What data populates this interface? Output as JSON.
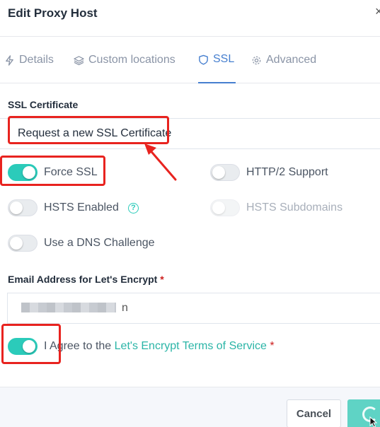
{
  "dialog": {
    "title": "Edit Proxy Host",
    "close_label": "×"
  },
  "tabs": [
    {
      "label": "Details",
      "icon": "bolt-icon",
      "active": false
    },
    {
      "label": "Custom locations",
      "icon": "layers-icon",
      "active": false
    },
    {
      "label": "SSL",
      "icon": "shield-icon",
      "active": true
    },
    {
      "label": "Advanced",
      "icon": "gear-icon",
      "active": false
    }
  ],
  "ssl": {
    "certificate_label": "SSL Certificate",
    "certificate_value": "Request a new SSL Certificate",
    "toggles": {
      "force_ssl": {
        "label": "Force SSL",
        "on": true
      },
      "http2": {
        "label": "HTTP/2 Support",
        "on": false
      },
      "hsts": {
        "label": "HSTS Enabled",
        "on": false,
        "help": "?"
      },
      "hsts_sub": {
        "label": "HSTS Subdomains",
        "on": false,
        "disabled": true
      },
      "dns": {
        "label": "Use a DNS Challenge",
        "on": false
      }
    },
    "email_label": "Email Address for Let's Encrypt",
    "required_mark": "*",
    "email_value_suffix": "n",
    "agree": {
      "prefix": "I Agree to the",
      "link": "Let's Encrypt Terms of Service",
      "on": true
    }
  },
  "footer": {
    "cancel_label": "Cancel"
  },
  "colors": {
    "accent": "#2bcbba",
    "tab_active": "#467fcf",
    "annotation": "#e8231f"
  }
}
